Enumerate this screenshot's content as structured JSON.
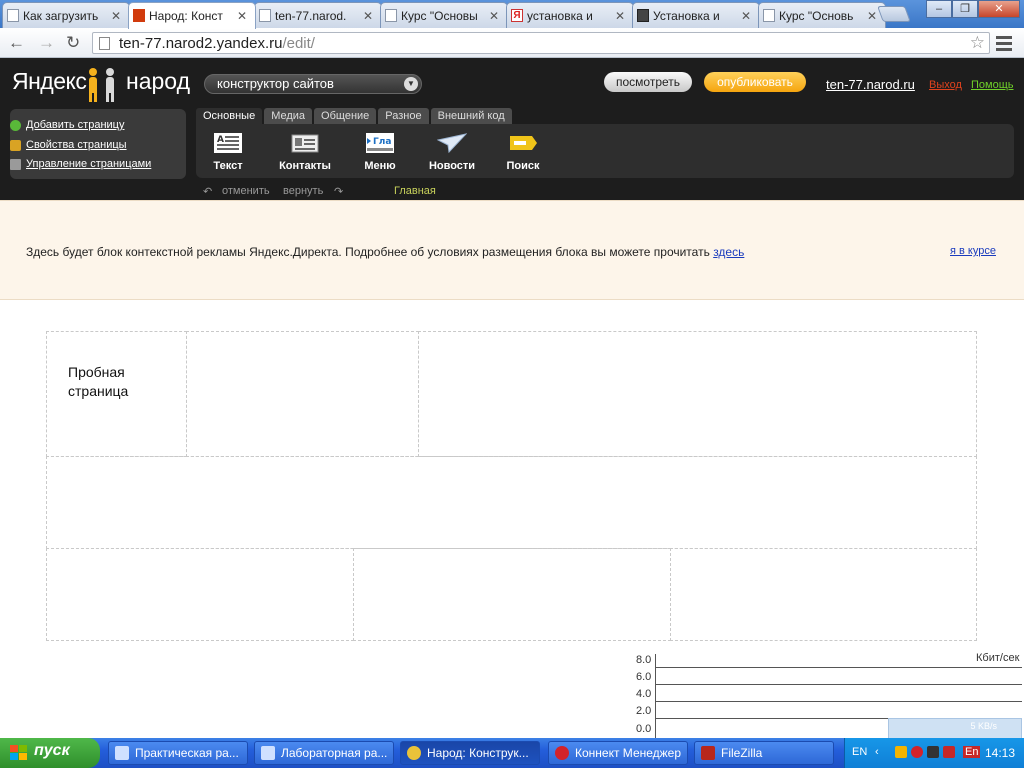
{
  "browser": {
    "tabs": [
      {
        "label": "Как загрузить",
        "icon": "page-icon"
      },
      {
        "label": "Народ: Конст",
        "icon": "narod-icon",
        "active": true
      },
      {
        "label": "ten-77.narod.",
        "icon": "page-icon"
      },
      {
        "label": "Курс \"Основы",
        "icon": "page-icon"
      },
      {
        "label": "установка и",
        "icon": "yandex-icon"
      },
      {
        "label": "Установка и",
        "icon": "install-icon"
      },
      {
        "label": "Курс \"Основь",
        "icon": "page-icon"
      }
    ],
    "url_host": "ten-77.narod2.yandex.ru",
    "url_path": "/edit/"
  },
  "narod": {
    "logo_left": "Яндекс",
    "logo_right": "народ",
    "constructor_label": "конструктор сайтов",
    "view_button": "посмотреть",
    "publish_button": "опубликовать",
    "site_link": "ten-77.narod.ru",
    "exit_link": "Выход",
    "help_link": "Помощь",
    "left_menu": [
      {
        "label": "Добавить страницу",
        "color": "#59b839"
      },
      {
        "label": "Свойства страницы",
        "color": "#d9a324"
      },
      {
        "label": "Управление страницами",
        "color": "#9a9a9a"
      }
    ],
    "tabs": [
      "Основные",
      "Медиа",
      "Общение",
      "Разное",
      "Внешний код"
    ],
    "tools": [
      "Текст",
      "Контакты",
      "Меню",
      "Новости",
      "Поиск"
    ],
    "menu_icon_text": "Гла",
    "undo_label": "отменить",
    "redo_label": "вернуть",
    "current_page": "Главная"
  },
  "ad": {
    "text": "Здесь будет блок контекстной рекламы Яндекс.Директа. Подробнее об условиях размещения блока вы можете прочитать",
    "link": "здесь",
    "dismiss": "я в курсе"
  },
  "page": {
    "name_line1": "Пробная",
    "name_line2": "страница"
  },
  "meter": {
    "unit": "Кбит/сек",
    "labels": [
      "8.0",
      "6.0",
      "4.0",
      "2.0",
      "0.0"
    ],
    "rate": "5 KB/s"
  },
  "taskbar": {
    "start": "пуск",
    "tasks": [
      {
        "label": "Практическая ра...",
        "color": "#cfe0ff"
      },
      {
        "label": "Лабораторная ра...",
        "color": "#cfe0ff"
      },
      {
        "label": "Народ: Конструк...",
        "color": "#e9c23a",
        "active": true
      },
      {
        "label": "Коннект Менеджер",
        "color": "#d3232a"
      },
      {
        "label": "FileZilla",
        "color": "#b8271c"
      }
    ],
    "lang": "EN",
    "lang2": "En",
    "clock": "14:13"
  }
}
